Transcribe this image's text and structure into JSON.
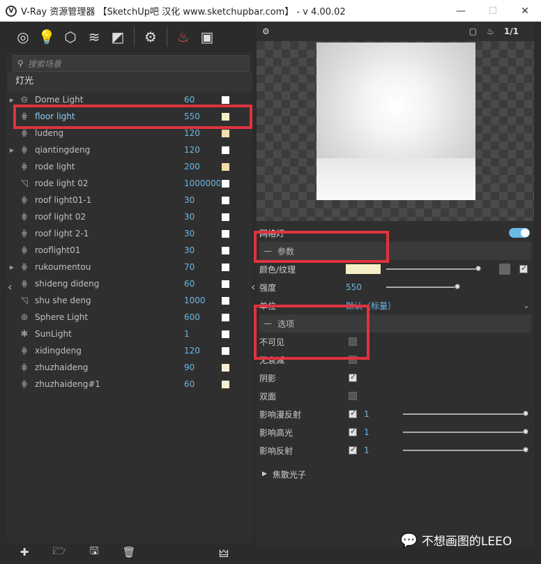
{
  "window": {
    "title": "V-Ray 资源管理器 【SketchUp吧 汉化 www.sketchupbar.com】 - v 4.00.02",
    "minimize": "—",
    "maximize": "☐",
    "close": "✕"
  },
  "search": {
    "placeholder": "搜索场景"
  },
  "section_label": "灯光",
  "lights": [
    {
      "name": "Dome Light",
      "value": "60",
      "swatch": "#ffffff",
      "expandable": true,
      "icon": "dome-icon"
    },
    {
      "name": "floor light",
      "value": "550",
      "swatch": "#f6eec4",
      "expandable": false,
      "icon": "mesh-light-icon",
      "selected": true
    },
    {
      "name": "ludeng",
      "value": "120",
      "swatch": "#f7deb0",
      "expandable": false,
      "icon": "mesh-light-icon"
    },
    {
      "name": "qiantingdeng",
      "value": "120",
      "swatch": "#ffffff",
      "expandable": true,
      "icon": "mesh-light-icon"
    },
    {
      "name": "rode light",
      "value": "200",
      "swatch": "#f7d7a9",
      "expandable": false,
      "icon": "mesh-light-icon"
    },
    {
      "name": "rode light 02",
      "value": "1000000(",
      "swatch": "#ffffff",
      "expandable": false,
      "icon": "spot-light-icon"
    },
    {
      "name": "roof light01-1",
      "value": "30",
      "swatch": "#ffffff",
      "expandable": false,
      "icon": "mesh-light-icon"
    },
    {
      "name": "roof light 02",
      "value": "30",
      "swatch": "#ffffff",
      "expandable": false,
      "icon": "mesh-light-icon"
    },
    {
      "name": "roof light 2-1",
      "value": "30",
      "swatch": "#ffffff",
      "expandable": false,
      "icon": "mesh-light-icon"
    },
    {
      "name": "rooflight01",
      "value": "30",
      "swatch": "#ffffff",
      "expandable": false,
      "icon": "mesh-light-icon"
    },
    {
      "name": "rukoumentou",
      "value": "70",
      "swatch": "#ffffff",
      "expandable": true,
      "icon": "mesh-light-icon"
    },
    {
      "name": "shideng dideng",
      "value": "60",
      "swatch": "#ffffff",
      "expandable": false,
      "icon": "mesh-light-icon"
    },
    {
      "name": "shu she deng",
      "value": "1000",
      "swatch": "#ffffff",
      "expandable": false,
      "icon": "spot-light-icon"
    },
    {
      "name": "Sphere Light",
      "value": "600",
      "swatch": "#ffffff",
      "expandable": false,
      "icon": "sphere-light-icon"
    },
    {
      "name": "SunLight",
      "value": "1",
      "swatch": "#ffffff",
      "expandable": false,
      "icon": "sun-icon"
    },
    {
      "name": "xidingdeng",
      "value": "120",
      "swatch": "#ffffff",
      "expandable": false,
      "icon": "mesh-light-icon"
    },
    {
      "name": "zhuzhaideng",
      "value": "90",
      "swatch": "#f8f0d0",
      "expandable": false,
      "icon": "mesh-light-icon"
    },
    {
      "name": "zhuzhaideng#1",
      "value": "60",
      "swatch": "#f8f0d0",
      "expandable": false,
      "icon": "mesh-light-icon"
    }
  ],
  "preview": {
    "render_label": "1/1"
  },
  "props": {
    "title": "网格灯",
    "section_params": "参数",
    "color_texture": "颜色/纹理",
    "color": "#f6eec4",
    "intensity_label": "强度",
    "intensity_value": "550",
    "unit_label": "单位",
    "unit_value": "默认（标量）",
    "section_options": "选项",
    "invisible": "不可见",
    "no_decay": "无衰减",
    "shadow": "阴影",
    "double_sided": "双面",
    "affect_diffuse": "影响漫反射",
    "affect_specular": "影响高光",
    "affect_reflection": "影响反射",
    "affect_value": "1",
    "caustics": "焦散光子"
  },
  "watermark": "不想画图的LEEO",
  "highlight_color": "#e0333f",
  "accent_color": "#6cb8e6"
}
